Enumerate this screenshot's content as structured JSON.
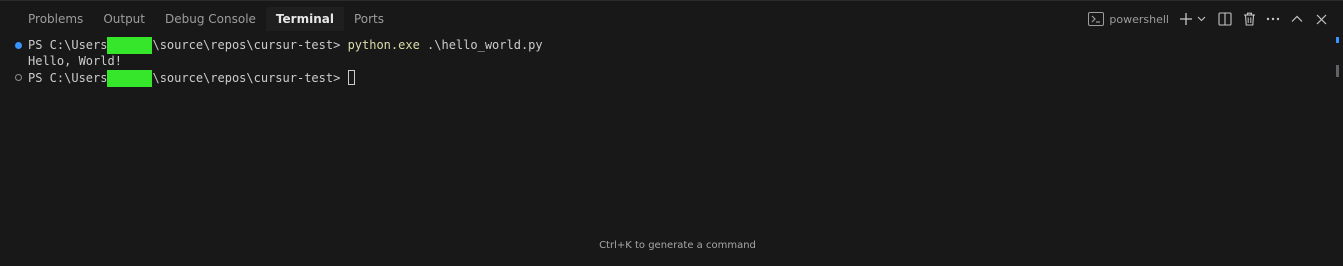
{
  "panel": {
    "tabs": [
      {
        "label": "Problems",
        "active": false
      },
      {
        "label": "Output",
        "active": false
      },
      {
        "label": "Debug Console",
        "active": false
      },
      {
        "label": "Terminal",
        "active": true
      },
      {
        "label": "Ports",
        "active": false
      }
    ],
    "actions": {
      "shell_icon": "terminal-powershell-icon",
      "shell_name": "powershell",
      "new_terminal_icon": "plus-icon",
      "launch_profile_icon": "chevron-down-icon",
      "split_icon": "split-terminal-icon",
      "kill_icon": "trash-icon",
      "more_icon": "ellipsis-icon",
      "maximize_icon": "chevron-up-icon",
      "close_icon": "close-icon"
    }
  },
  "terminal": {
    "lines": [
      {
        "decoration": "success",
        "prompt_prefix": "PS C:\\Users",
        "prompt_suffix": "\\source\\repos\\cursur-test> ",
        "command_name": "python.exe",
        "command_args": " .\\hello_world.py"
      },
      {
        "output": "Hello, World!"
      },
      {
        "decoration": "pending",
        "prompt_prefix": "PS C:\\Users",
        "prompt_suffix": "\\source\\repos\\cursur-test> "
      }
    ],
    "hint": "Ctrl+K to generate a command"
  },
  "colors": {
    "background": "#181818",
    "accent": "#3794ff",
    "command": "#dcdcaa",
    "redaction": "#36e62a"
  }
}
